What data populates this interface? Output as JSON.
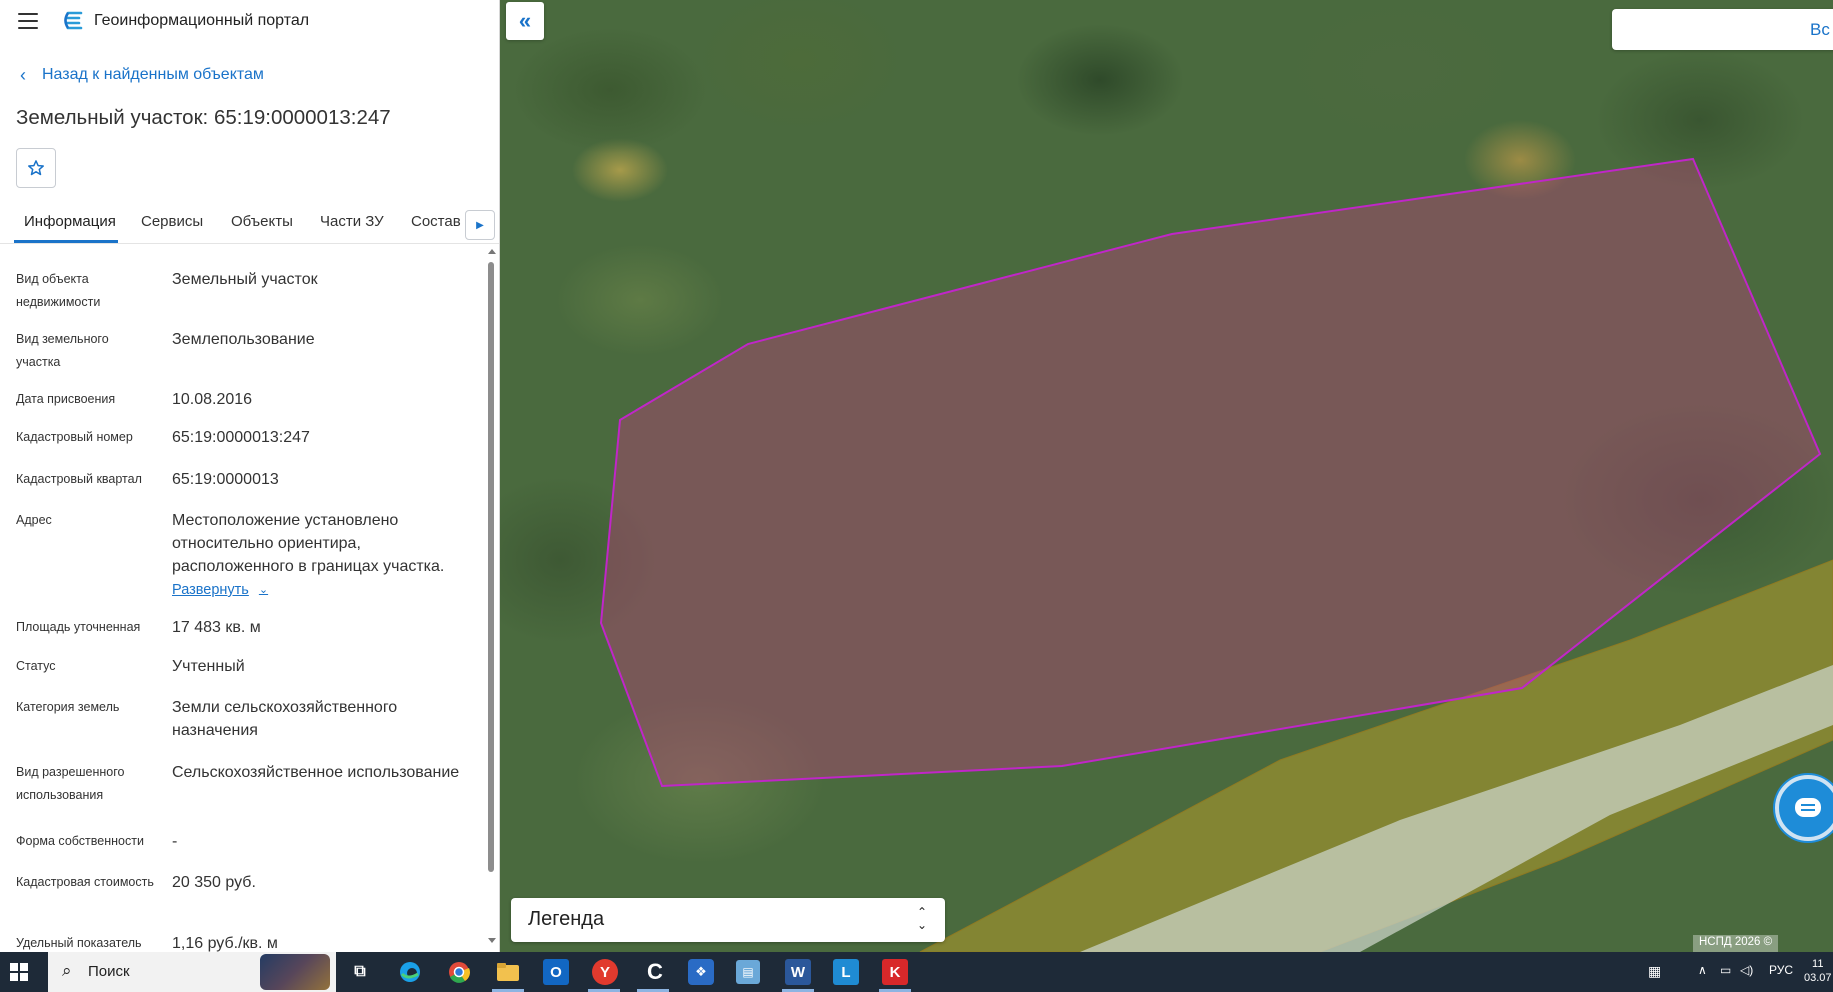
{
  "app": {
    "title": "Геоинформационный портал",
    "menu_icon": "hamburger-icon",
    "logo_icon": "portal-logo-icon"
  },
  "nav": {
    "back_label": "Назад к найденным объектам"
  },
  "object": {
    "title": "Земельный участок: 65:19:0000013:247"
  },
  "tabs": [
    {
      "label": "Информация",
      "active": true
    },
    {
      "label": "Сервисы",
      "active": false
    },
    {
      "label": "Объекты",
      "active": false
    },
    {
      "label": "Части ЗУ",
      "active": false
    },
    {
      "label": "Состав",
      "active": false
    }
  ],
  "info": {
    "rows": [
      {
        "label": "Вид объекта недвижимости",
        "value": "Земельный участок"
      },
      {
        "label": "Вид земельного участка",
        "value": "Землепользование"
      },
      {
        "label": "Дата присвоения",
        "value": "10.08.2016"
      },
      {
        "label": "Кадастровый номер",
        "value": "65:19:0000013:247"
      },
      {
        "label": "Кадастровый квартал",
        "value": "65:19:0000013"
      },
      {
        "label": "Адрес",
        "value": "Местоположение установлено относительно ориентира, расположенного в границах участка.",
        "expand_label": "Развернуть"
      },
      {
        "label": "Площадь уточненная",
        "value": "17 483 кв. м"
      },
      {
        "label": "Статус",
        "value": "Учтенный"
      },
      {
        "label": "Категория земель",
        "value": "Земли сельскохозяйственного назначения"
      },
      {
        "label": "Вид разрешенного использования",
        "value": "Сельскохозяйственное использование"
      },
      {
        "label": "Форма собственности",
        "value": "-"
      },
      {
        "label": "Кадастровая стоимость",
        "value": "20 350 руб."
      },
      {
        "label": "Удельный показатель",
        "value": "1,16 руб./кв. м"
      }
    ]
  },
  "map": {
    "search_partial": "Вс",
    "legend_label": "Легенда",
    "copyright": "НСПД 2026 ©",
    "parcel_stroke_color": "#c026c8",
    "parcel_fill_color": "#b8407a",
    "zone_fill_color": "#b39a2a"
  },
  "taskbar": {
    "search_label": "Поиск",
    "language": "РУС",
    "time_partial": "11",
    "date_partial": "03.07"
  },
  "colors": {
    "accent": "#1a73c9",
    "taskbar_bg": "#1e2a38"
  }
}
